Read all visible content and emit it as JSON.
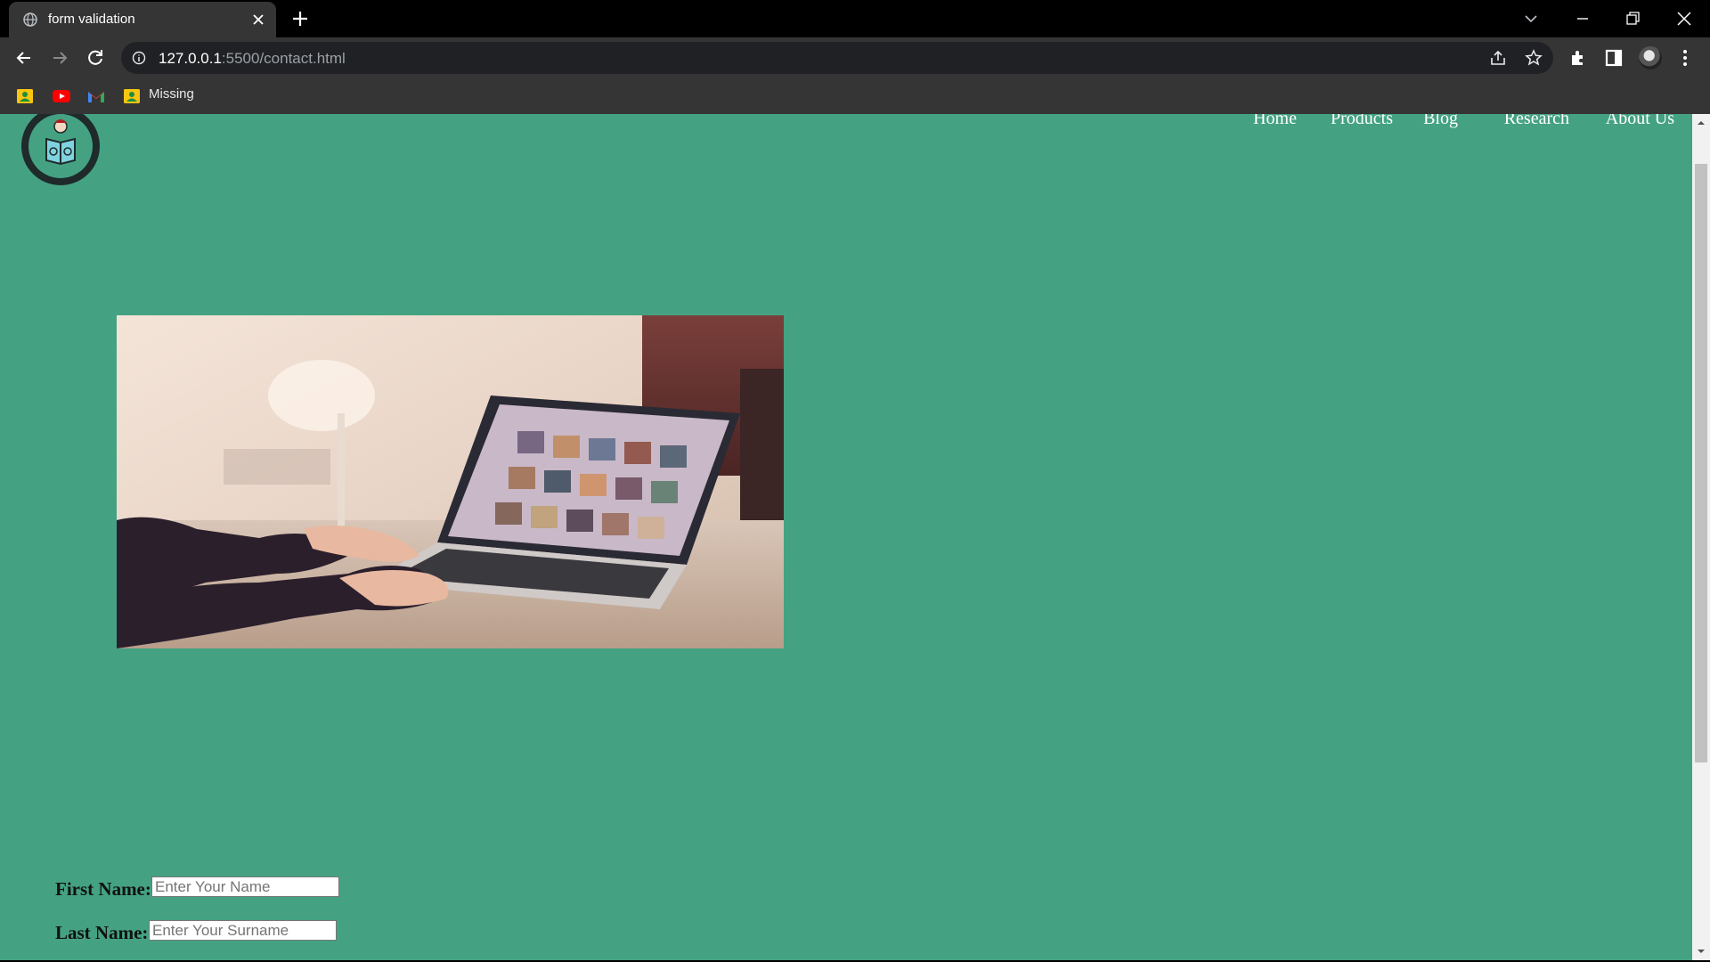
{
  "browser": {
    "tab_title": "form validation",
    "url_host": "127.0.0.1",
    "url_path": ":5500/contact.html",
    "bookmarks": {
      "missing_label": "Missing"
    }
  },
  "page": {
    "nav": [
      "Home",
      "Products",
      "Blog",
      "Research",
      "About Us"
    ],
    "form": {
      "first_name_label": "First Name:",
      "first_name_placeholder": "Enter Your Name",
      "last_name_label": "Last Name:",
      "last_name_placeholder": "Enter Your Surname"
    }
  },
  "icons": {
    "tab_favicon": "globe-icon",
    "logo": "reading-person-icon",
    "hero": "laptop-photo"
  },
  "colors": {
    "page_background": "#44a283",
    "chrome_dark": "#000000",
    "chrome_toolbar": "#353535",
    "omnibox": "#202124"
  }
}
